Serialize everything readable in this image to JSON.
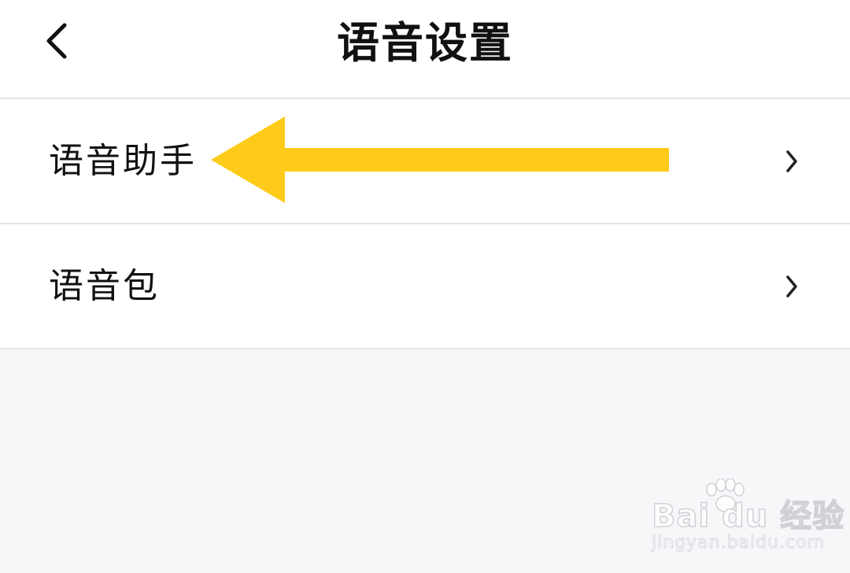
{
  "header": {
    "title": "语音设置",
    "back_icon": "chevron-left-icon"
  },
  "settings": [
    {
      "label": "语音助手",
      "icon": "chevron-right-icon"
    },
    {
      "label": "语音包",
      "icon": "chevron-right-icon"
    }
  ],
  "annotation": {
    "arrow_color": "#fecb1a",
    "direction": "left"
  },
  "watermark": {
    "brand": "Bai du 经验",
    "url": "jingyan.baidu.com",
    "icon": "paw-icon"
  },
  "colors": {
    "background": "#f6f7f9",
    "surface": "#ffffff",
    "divider": "#e3e4e6",
    "text": "#111111"
  }
}
